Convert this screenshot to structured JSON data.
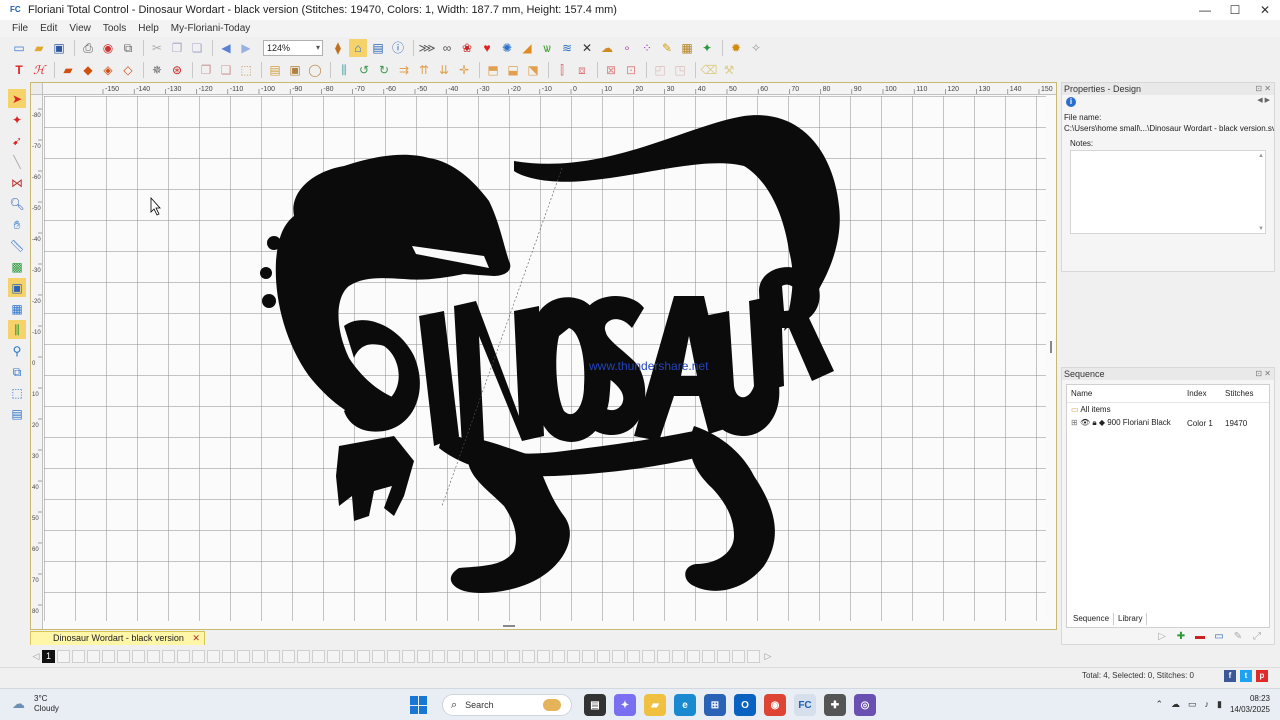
{
  "window": {
    "app_icon": "FC",
    "title": "Floriani Total Control - Dinosaur Wordart - black version (Stitches: 19470, Colors: 1, Width: 187.7 mm, Height: 157.4 mm)"
  },
  "menu": [
    "File",
    "Edit",
    "View",
    "Tools",
    "Help",
    "My-Floriani-Today"
  ],
  "toolbar": {
    "zoom": "124%"
  },
  "canvas": {
    "ruler_top": [
      "-150",
      "-140",
      "-130",
      "-120",
      "-110",
      "-100",
      "-90",
      "-80",
      "-70",
      "-60",
      "-50",
      "-40",
      "-30",
      "-20",
      "-10",
      "0",
      "10",
      "20",
      "30",
      "40",
      "50",
      "60",
      "70",
      "80",
      "90",
      "100",
      "110",
      "120",
      "130",
      "140",
      "150"
    ],
    "ruler_left": [
      "-80",
      "-70",
      "-60",
      "-50",
      "-40",
      "-30",
      "-20",
      "-10",
      "0",
      "10",
      "20",
      "30",
      "40",
      "50",
      "60",
      "70",
      "80",
      "90"
    ],
    "design_word": "DINOSAUR",
    "watermark": "www.thundershare.net",
    "fill_color": "#0b0b0b"
  },
  "document_tab": {
    "label": "Dinosaur Wordart - black version",
    "close": "✕"
  },
  "page_strip": {
    "active": "1",
    "count": 48
  },
  "properties": {
    "header": "Properties - Design",
    "file_name_label": "File name:",
    "file_name_value": "C:\\Users\\home small\\...\\Dinosaur Wordart - black version.svg",
    "notes_label": "Notes:"
  },
  "sequence": {
    "header": "Sequence",
    "columns": [
      "Name",
      "Index",
      "Stitches"
    ],
    "all_items": "All items",
    "row": {
      "name": "900 Floriani Black",
      "index": "Color 1",
      "stitches": "19470"
    },
    "tabs": [
      "Sequence",
      "Library"
    ]
  },
  "status": {
    "text": "Total: 4, Selected: 0, Stitches: 0"
  },
  "taskbar": {
    "temperature": "3°C",
    "condition": "Cloudy",
    "search_placeholder": "Search",
    "time": "08:23",
    "date": "14/03/2025"
  }
}
